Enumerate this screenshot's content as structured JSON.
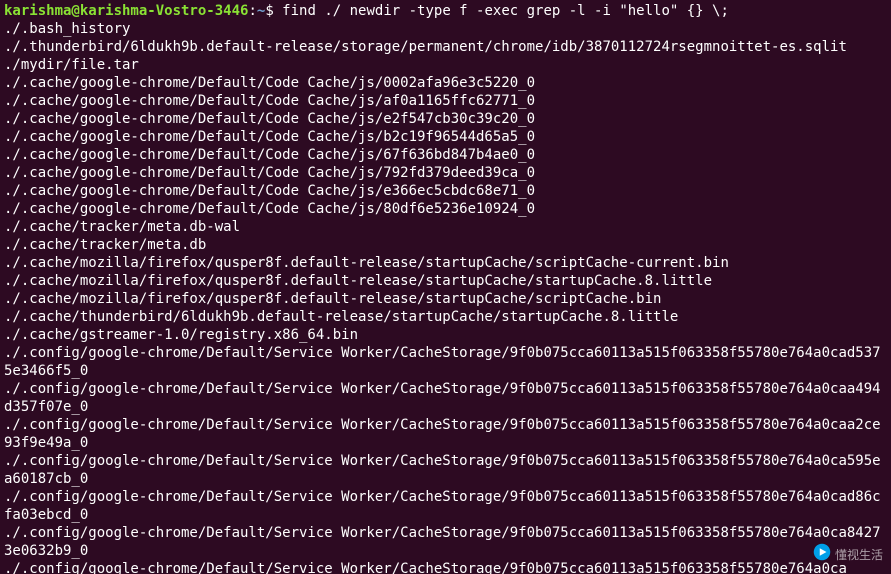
{
  "prompt": {
    "user": "karishma@karishma-Vostro-3446",
    "colon": ":",
    "path": "~",
    "dollar": "$ "
  },
  "command": "find ./ newdir -type f -exec grep -l -i \"hello\" {} \\;",
  "output_lines": [
    "./.bash_history",
    "./.thunderbird/6ldukh9b.default-release/storage/permanent/chrome/idb/3870112724rsegmnoittet-es.sqlit",
    "./mydir/file.tar",
    "./.cache/google-chrome/Default/Code Cache/js/0002afa96e3c5220_0",
    "./.cache/google-chrome/Default/Code Cache/js/af0a1165ffc62771_0",
    "./.cache/google-chrome/Default/Code Cache/js/e2f547cb30c39c20_0",
    "./.cache/google-chrome/Default/Code Cache/js/b2c19f96544d65a5_0",
    "./.cache/google-chrome/Default/Code Cache/js/67f636bd847b4ae0_0",
    "./.cache/google-chrome/Default/Code Cache/js/792fd379deed39ca_0",
    "./.cache/google-chrome/Default/Code Cache/js/e366ec5cbdc68e71_0",
    "./.cache/google-chrome/Default/Code Cache/js/80df6e5236e10924_0",
    "./.cache/tracker/meta.db-wal",
    "./.cache/tracker/meta.db",
    "./.cache/mozilla/firefox/qusper8f.default-release/startupCache/scriptCache-current.bin",
    "./.cache/mozilla/firefox/qusper8f.default-release/startupCache/startupCache.8.little",
    "./.cache/mozilla/firefox/qusper8f.default-release/startupCache/scriptCache.bin",
    "./.cache/thunderbird/6ldukh9b.default-release/startupCache/startupCache.8.little",
    "./.cache/gstreamer-1.0/registry.x86_64.bin",
    "./.config/google-chrome/Default/Service Worker/CacheStorage/9f0b075cca60113a515f063358f55780e764a0cad5375e3466f5_0",
    "./.config/google-chrome/Default/Service Worker/CacheStorage/9f0b075cca60113a515f063358f55780e764a0caa494d357f07e_0",
    "./.config/google-chrome/Default/Service Worker/CacheStorage/9f0b075cca60113a515f063358f55780e764a0caa2ce93f9e49a_0",
    "./.config/google-chrome/Default/Service Worker/CacheStorage/9f0b075cca60113a515f063358f55780e764a0ca595ea60187cb_0",
    "./.config/google-chrome/Default/Service Worker/CacheStorage/9f0b075cca60113a515f063358f55780e764a0cad86cfa03ebcd_0",
    "./.config/google-chrome/Default/Service Worker/CacheStorage/9f0b075cca60113a515f063358f55780e764a0ca84273e0632b9_0",
    "./.config/google-chrome/Default/Service Worker/CacheStorage/9f0b075cca60113a515f063358f55780e764a0ca"
  ],
  "watermark": "懂视生活"
}
